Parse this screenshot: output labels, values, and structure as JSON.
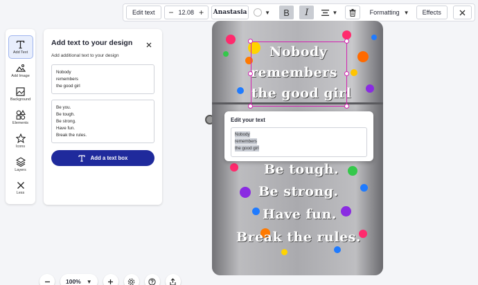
{
  "toolbar": {
    "edit_text": "Edit text",
    "font_size": "12.08",
    "minus": "−",
    "plus": "+",
    "font_name": "Anastasia",
    "bold": "B",
    "italic": "I",
    "formatting": "Formatting",
    "effects": "Effects"
  },
  "rail": {
    "items": [
      {
        "label": "Add Text",
        "icon": "text-icon"
      },
      {
        "label": "Add Image",
        "icon": "image-icon"
      },
      {
        "label": "Background",
        "icon": "background-icon"
      },
      {
        "label": "Elements",
        "icon": "elements-icon"
      },
      {
        "label": "Icons",
        "icon": "star-icon"
      },
      {
        "label": "Layers",
        "icon": "layers-icon"
      },
      {
        "label": "Less",
        "icon": "close-icon"
      }
    ]
  },
  "panel": {
    "title": "Add text to your design",
    "subtitle": "Add additional text to your design",
    "text1": [
      "Nobody",
      "remembers",
      "the good girl"
    ],
    "text2": [
      "Be you.",
      "Be tough.",
      "Be strong.",
      "Have fun.",
      "Break the rules."
    ],
    "add_button": "Add a text box"
  },
  "design": {
    "lines_top": [
      "Nobody",
      "remembers",
      "the good girl"
    ],
    "lines_bottom": [
      "Be tough.",
      "Be strong.",
      "Have fun.",
      "Break the rules."
    ]
  },
  "popover": {
    "title": "Edit your text",
    "lines": [
      "Nobody",
      "remembers",
      "the good girl"
    ]
  },
  "bottom": {
    "zoom": "100%"
  },
  "colors": {
    "accent": "#1f2a9c",
    "selection": "#d321b0"
  }
}
